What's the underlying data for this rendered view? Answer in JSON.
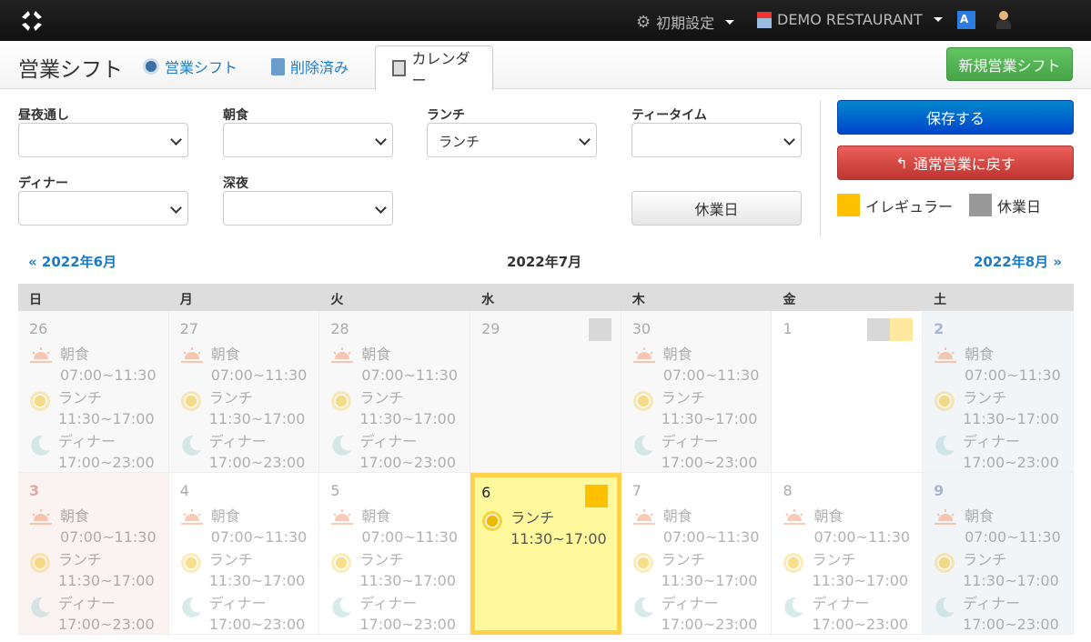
{
  "topbar": {
    "settings_label": "初期設定",
    "restaurant_label": "DEMO RESTAURANT"
  },
  "header": {
    "title": "営業シフト",
    "tabs": [
      {
        "label": "営業シフト"
      },
      {
        "label": "削除済み"
      },
      {
        "label": "カレンダー"
      }
    ],
    "new_button": "新規営業シフト"
  },
  "form": {
    "fields": [
      {
        "label": "昼夜通し",
        "value": ""
      },
      {
        "label": "朝食",
        "value": ""
      },
      {
        "label": "ランチ",
        "value": "ランチ"
      },
      {
        "label": "ティータイム",
        "value": ""
      },
      {
        "label": "ディナー",
        "value": ""
      },
      {
        "label": "深夜",
        "value": ""
      }
    ],
    "holiday_button": "休業日",
    "save_button": "保存する",
    "revert_button": "通常営業に戻す",
    "legend": [
      {
        "label": "イレギュラー",
        "color": "#ffc000"
      },
      {
        "label": "休業日",
        "color": "#999999"
      }
    ]
  },
  "calendar": {
    "prev": "« 2022年6月",
    "current": "2022年7月",
    "next": "2022年8月 »",
    "weekdays": [
      "日",
      "月",
      "火",
      "水",
      "木",
      "金",
      "土"
    ],
    "weeks": [
      [
        {
          "day": "26",
          "type": "past",
          "entries": "full"
        },
        {
          "day": "27",
          "type": "past",
          "entries": "full"
        },
        {
          "day": "28",
          "type": "past",
          "entries": "full"
        },
        {
          "day": "29",
          "type": "past",
          "entries": "none",
          "markers": [
            "#d8d8d8"
          ]
        },
        {
          "day": "30",
          "type": "past",
          "entries": "full"
        },
        {
          "day": "1",
          "type": "",
          "entries": "none",
          "markers": [
            "#d8d8d8",
            "#ffe9a0"
          ]
        },
        {
          "day": "2",
          "type": "sat",
          "entries": "full"
        }
      ],
      [
        {
          "day": "3",
          "type": "sun",
          "entries": "full"
        },
        {
          "day": "4",
          "type": "",
          "entries": "full"
        },
        {
          "day": "5",
          "type": "",
          "entries": "full"
        },
        {
          "day": "6",
          "type": "hl",
          "entries": "lunch",
          "markers": [
            "#ffc000"
          ]
        },
        {
          "day": "7",
          "type": "",
          "entries": "full"
        },
        {
          "day": "8",
          "type": "",
          "entries": "full"
        },
        {
          "day": "9",
          "type": "sat",
          "entries": "full"
        }
      ]
    ],
    "shifts": {
      "breakfast": {
        "name": "朝食",
        "time": "07:00~11:30"
      },
      "lunch": {
        "name": "ランチ",
        "time": "11:30~17:00"
      },
      "dinner": {
        "name": "ディナー",
        "time": "17:00~23:00"
      }
    }
  }
}
